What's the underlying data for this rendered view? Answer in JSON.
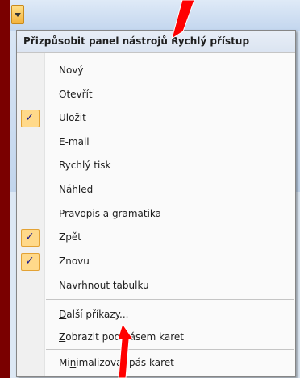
{
  "menu": {
    "header": "Přizpůsobit panel nástrojů Rychlý přístup",
    "items": [
      {
        "label": "Nový",
        "checked": false
      },
      {
        "label": "Otevřít",
        "checked": false
      },
      {
        "label": "Uložit",
        "checked": true
      },
      {
        "label": "E-mail",
        "checked": false
      },
      {
        "label": "Rychlý tisk",
        "checked": false
      },
      {
        "label": "Náhled",
        "checked": false
      },
      {
        "label": "Pravopis a gramatika",
        "checked": false
      },
      {
        "label": "Zpět",
        "checked": true
      },
      {
        "label": "Znovu",
        "checked": true
      },
      {
        "label": "Navrhnout tabulku",
        "checked": false
      }
    ],
    "more_commands": {
      "mnemonic": "D",
      "rest": "alší příkazy..."
    },
    "show_below": {
      "mnemonic": "Z",
      "rest": "obrazit pod pásem karet"
    },
    "minimize": {
      "before": "Mi",
      "mnemonic": "n",
      "rest": "imalizovat pás karet"
    }
  },
  "check_glyph": "✓",
  "colors": {
    "background": "#7a0000",
    "menu_bg": "#fafafa",
    "check_bg": "#ffd98a",
    "check_border": "#e3a234",
    "callout": "#ff0000"
  }
}
